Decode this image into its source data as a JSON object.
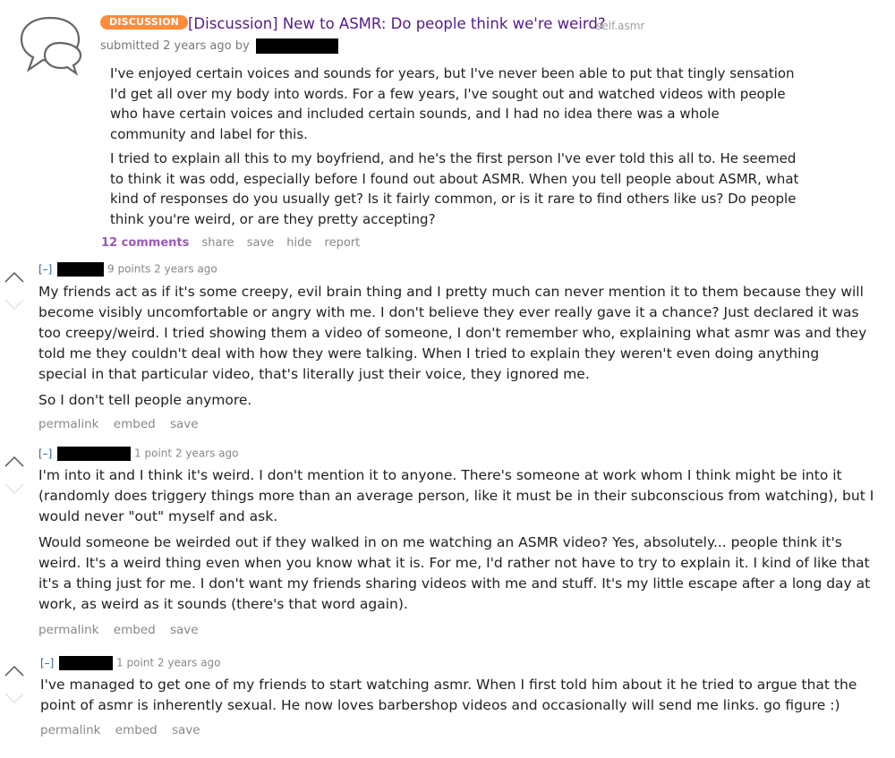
{
  "post": {
    "icon": "speech-bubbles-icon",
    "flair": "DISCUSSION",
    "title": "[Discussion] New to ASMR: Do people think we're weird?",
    "domain": "self.asmr",
    "submitted": "submitted 2 years ago by",
    "body": [
      "I've enjoyed certain voices and sounds for years, but I've never been able to put that tingly sensation I'd get all over my body into words. For a few years, I've sought out and watched videos with people who have certain voices and included certain sounds, and I had no idea there was a whole community and label for this.",
      "I tried to explain all this to my boyfriend, and he's the first person I've ever told this all to. He seemed to think it was odd, especially before I found out about ASMR. When you tell people about ASMR, what kind of responses do you usually get? Is it fairly common, or is it rare to find others like us? Do people think you're weird, or are they pretty accepting?"
    ],
    "actions": {
      "comments": "12 comments",
      "share": "share",
      "save": "save",
      "hide": "hide",
      "report": "report"
    }
  },
  "comments": [
    {
      "toggle": "[–]",
      "meta": "9 points 2 years ago",
      "body": [
        "My friends act as if it's some creepy, evil brain thing and I pretty much can never mention it to them because they will become visibly uncomfortable or angry with me. I don't believe they ever really gave it a chance? Just declared it was too creepy/weird. I tried showing them a video of someone, I don't remember who, explaining what asmr was and they told me they couldn't deal with how they were talking. When I tried to explain they weren't even doing anything special in that particular video, that's literally just their voice, they ignored me.",
        "So I don't tell people anymore."
      ],
      "actions": {
        "permalink": "permalink",
        "embed": "embed",
        "save": "save"
      }
    },
    {
      "toggle": "[–]",
      "meta": "1 point 2 years ago",
      "body": [
        "I'm into it and I think it's weird. I don't mention it to anyone. There's someone at work whom I think might be into it (randomly does triggery things more than an average person, like it must be in their subconscious from watching), but I would never \"out\" myself and ask.",
        "Would someone be weirded out if they walked in on me watching an ASMR video? Yes, absolutely... people think it's weird. It's a weird thing even when you know what it is. For me, I'd rather not have to try to explain it. I kind of like that it's a thing just for me. I don't want my friends sharing videos with me and stuff. It's my little escape after a long day at work, as weird as it sounds (there's that word again)."
      ],
      "actions": {
        "permalink": "permalink",
        "embed": "embed",
        "save": "save"
      }
    },
    {
      "toggle": "[–]",
      "meta": "1 point 2 years ago",
      "body": [
        "I've managed to get one of my friends to start watching asmr. When I first told him about it he tried to argue that the point of asmr is inherently sexual. He now loves barbershop videos and occasionally will send me links. go figure :)"
      ],
      "actions": {
        "permalink": "permalink",
        "embed": "embed",
        "save": "save"
      }
    }
  ],
  "colors": {
    "flair": "#ff8b3d",
    "title": "#551a8b",
    "comments_link": "#9b59b6",
    "muted": "#888888"
  }
}
